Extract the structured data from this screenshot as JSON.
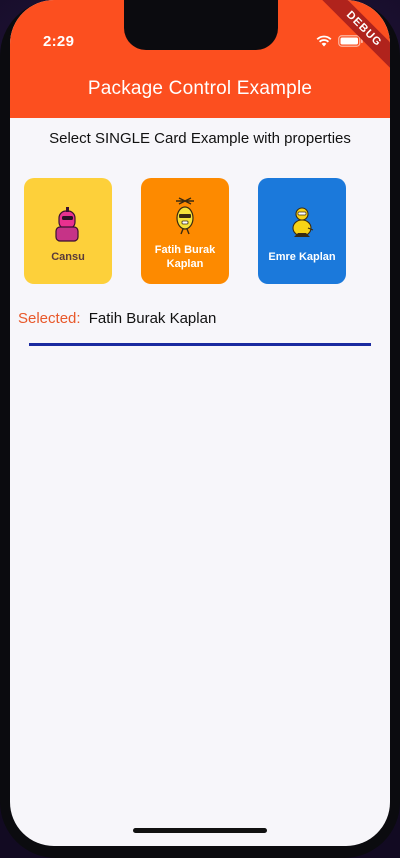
{
  "status_bar": {
    "time": "2:29",
    "icons": [
      "wifi-icon",
      "battery-icon"
    ],
    "debug_banner": "DEBUG"
  },
  "app_bar": {
    "title": "Package Control Example",
    "color": "#fc4f1f"
  },
  "main": {
    "subtitle": "Select SINGLE Card Example with properties",
    "cards": [
      {
        "label": "Cansu",
        "color": "#fdd03a",
        "icon": "pink-character-icon"
      },
      {
        "label": "Fatih Burak Kaplan",
        "color": "#fd8a00",
        "icon": "yellow-character-icon"
      },
      {
        "label": "Emre Kaplan",
        "color": "#1b79db",
        "icon": "duck-character-icon"
      }
    ],
    "selected_label": "Selected:",
    "selected_value": "Fatih Burak Kaplan",
    "divider_color": "#1a2aa0"
  }
}
